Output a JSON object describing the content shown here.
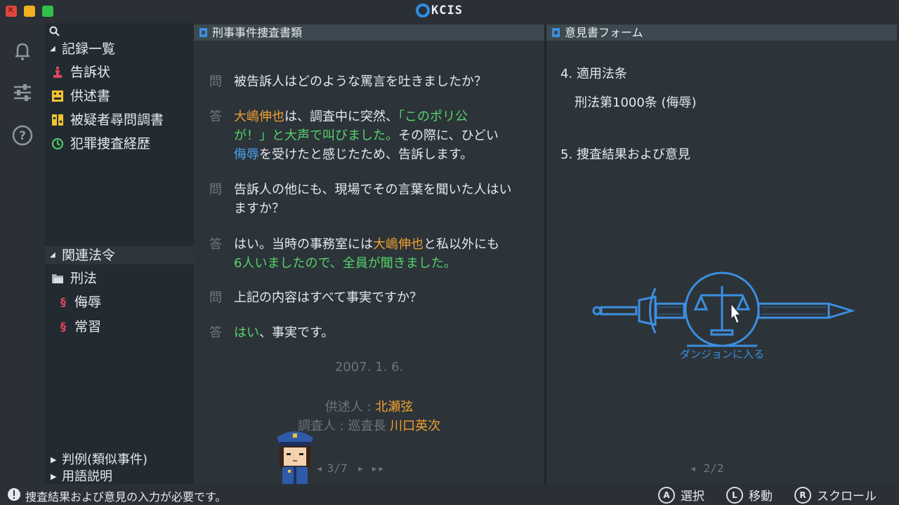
{
  "window": {
    "app_name": "KCIS"
  },
  "sidebar": {
    "records_title": "記録一覧",
    "records": [
      {
        "label": "告訴状",
        "icon": "pawn-icon",
        "color": "#e0455a"
      },
      {
        "label": "供述書",
        "icon": "pixel-face-icon",
        "color": "#f2c230"
      },
      {
        "label": "被疑者尋問調書",
        "icon": "pixel-face-icon",
        "color": "#f2c230"
      },
      {
        "label": "犯罪捜査経歴",
        "icon": "history-icon",
        "color": "#56d36a"
      }
    ],
    "laws_title": "関連法令",
    "law_folder": "刑法",
    "laws": [
      {
        "label": "侮辱"
      },
      {
        "label": "常習"
      }
    ],
    "footer_items": [
      {
        "label": "判例(類似事件)"
      },
      {
        "label": "用語説明"
      }
    ]
  },
  "doc_panel": {
    "title": "刑事事件捜査書類",
    "q_label": "問",
    "a_label": "答",
    "qa": [
      {
        "q": "被告訴人はどのような罵言を吐きましたか？"
      },
      {
        "a1_name": "大嶋伸也",
        "a1_text1": "は、調査中に突然、",
        "a1_quote1": "「このポリ公",
        "a1_quote2": "が！」と大声で叫びました。",
        "a1_text2": "その際に、ひどい",
        "a1_insult": "侮辱",
        "a1_text3": "を受けたと感じたため、告訴します。"
      },
      {
        "q2": "告訴人の他にも、現場でその言葉を聞いた人はいますか？"
      },
      {
        "a2_text1": "はい。当時の事務室には",
        "a2_name": "大嶋伸也",
        "a2_text2": "と私以外にも",
        "a2_green": "6人いましたので、全員が聞きました。"
      },
      {
        "q3": "上記の内容はすべて事実ですか？"
      },
      {
        "a3_green": "はい",
        "a3_text": "、事実です。"
      }
    ],
    "date": "2007. 1. 6.",
    "deponent_label": "供述人 : ",
    "deponent_name": "北瀬弦",
    "investigator_label": "調査人 : 巡査長 ",
    "investigator_name": "川口英次",
    "page": "3/7"
  },
  "form_panel": {
    "title": "意見書フォーム",
    "section4": "4. 適用法条",
    "law_ref": "刑法第1000条 (侮辱)",
    "section5": "5. 捜査結果および意見",
    "dungeon_label": "ダンジョンに入る",
    "page": "2/2"
  },
  "status": {
    "message": "捜査結果および意見の入力が必要です。",
    "controls": [
      {
        "key": "A",
        "label": "選択"
      },
      {
        "key": "L",
        "label": "移動"
      },
      {
        "key": "R",
        "label": "スクロール"
      }
    ]
  },
  "colors": {
    "accent_blue": "#3b8fe0",
    "orange": "#f0a030",
    "green": "#56d36a",
    "red": "#e4503e"
  }
}
